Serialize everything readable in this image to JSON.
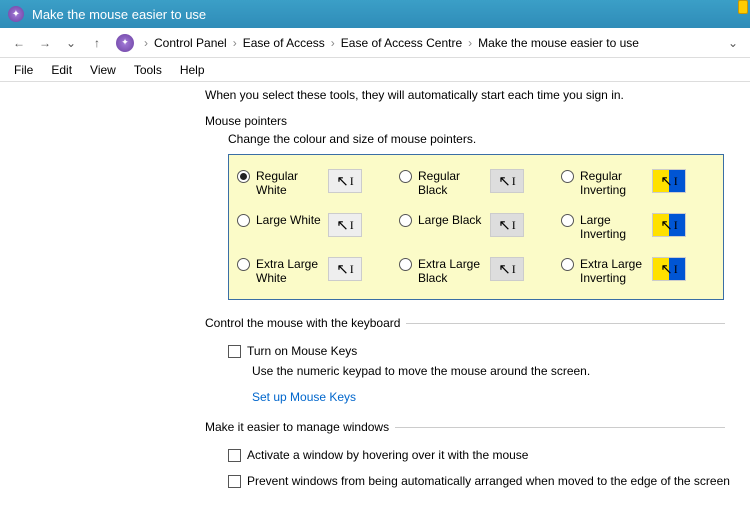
{
  "window": {
    "title": "Make the mouse easier to use"
  },
  "breadcrumb": [
    "Control Panel",
    "Ease of Access",
    "Ease of Access Centre",
    "Make the mouse easier to use"
  ],
  "menus": [
    "File",
    "Edit",
    "View",
    "Tools",
    "Help"
  ],
  "intro": "When you select these tools, they will automatically start each time you sign in.",
  "sections": {
    "pointers": {
      "title": "Mouse pointers",
      "subtitle": "Change the colour and size of mouse pointers.",
      "options": [
        [
          {
            "label": "Regular White",
            "selected": true,
            "style": "w"
          },
          {
            "label": "Regular Black",
            "selected": false,
            "style": "b"
          },
          {
            "label": "Regular Inverting",
            "selected": false,
            "style": "i"
          }
        ],
        [
          {
            "label": "Large White",
            "selected": false,
            "style": "w"
          },
          {
            "label": "Large Black",
            "selected": false,
            "style": "b"
          },
          {
            "label": "Large Inverting",
            "selected": false,
            "style": "i"
          }
        ],
        [
          {
            "label": "Extra Large White",
            "selected": false,
            "style": "w"
          },
          {
            "label": "Extra Large Black",
            "selected": false,
            "style": "b"
          },
          {
            "label": "Extra Large Inverting",
            "selected": false,
            "style": "i"
          }
        ]
      ]
    },
    "keyboard": {
      "title": "Control the mouse with the keyboard",
      "check": "Turn on Mouse Keys",
      "desc": "Use the numeric keypad to move the mouse around the screen.",
      "link": "Set up Mouse Keys"
    },
    "windows": {
      "title": "Make it easier to manage windows",
      "check1": "Activate a window by hovering over it with the mouse",
      "check2": "Prevent windows from being automatically arranged when moved to the edge of the screen"
    }
  }
}
